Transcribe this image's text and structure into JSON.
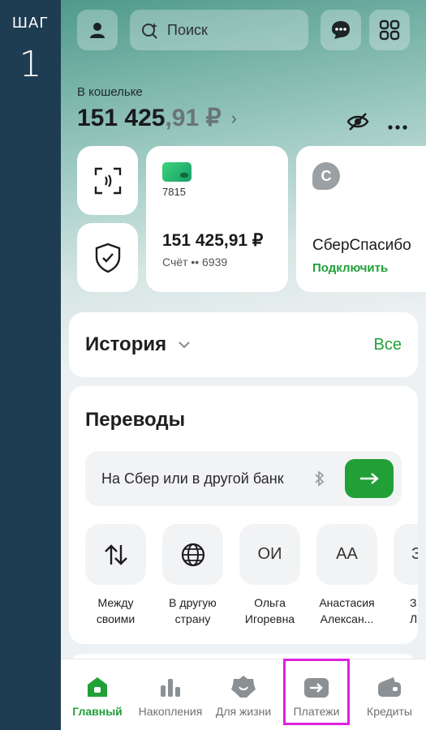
{
  "step": {
    "label": "ШАГ",
    "number": "1"
  },
  "topbar": {
    "search_placeholder": "Поиск"
  },
  "wallet": {
    "label": "В кошельке",
    "amount_main": "151 425",
    "amount_dec": ",91 ₽",
    "chevron": "›"
  },
  "card": {
    "digits": "7815",
    "balance": "151 425,91 ₽",
    "account": "Счёт •• 6939"
  },
  "spasibo": {
    "logo": "С",
    "title": "СберСпасибо",
    "action": "Подключить"
  },
  "history": {
    "title": "История",
    "all": "Все"
  },
  "transfers": {
    "title": "Переводы",
    "search_text": "На Сбер или в другой банк",
    "quick": [
      {
        "icon": "arrows-icon",
        "line1": "Между",
        "line2": "своими"
      },
      {
        "icon": "globe-icon",
        "line1": "В другую",
        "line2": "страну"
      },
      {
        "initials": "ОИ",
        "line1": "Ольга",
        "line2": "Игоревна"
      },
      {
        "initials": "АА",
        "line1": "Анастасия",
        "line2": "Алексан..."
      },
      {
        "initials": "З",
        "line1": "З",
        "line2": "Леон"
      }
    ]
  },
  "tabs": [
    {
      "label": "Главный",
      "active": true
    },
    {
      "label": "Накопления"
    },
    {
      "label": "Для жизни"
    },
    {
      "label": "Платежи"
    },
    {
      "label": "Кредиты"
    }
  ],
  "colors": {
    "accent": "#21a038",
    "highlight": "#e020e0",
    "sidebar": "#1e3c52"
  }
}
